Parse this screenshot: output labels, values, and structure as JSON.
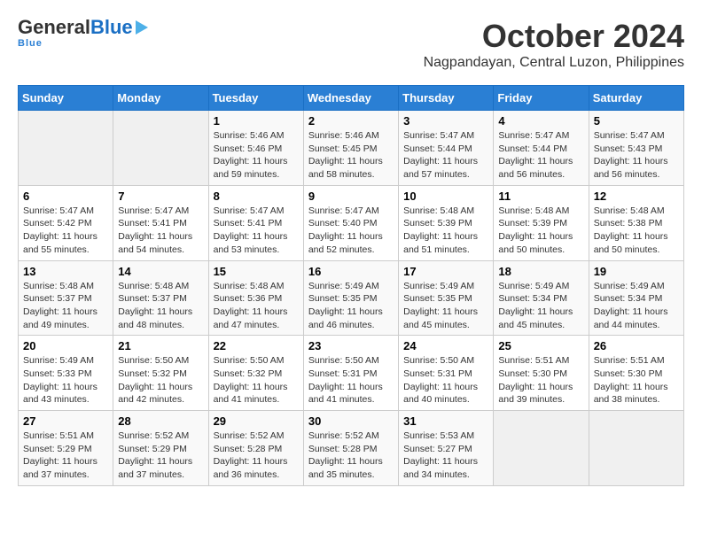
{
  "header": {
    "logo_general": "General",
    "logo_blue": "Blue",
    "month_title": "October 2024",
    "location": "Nagpandayan, Central Luzon, Philippines"
  },
  "days_of_week": [
    "Sunday",
    "Monday",
    "Tuesday",
    "Wednesday",
    "Thursday",
    "Friday",
    "Saturday"
  ],
  "weeks": [
    [
      {
        "day": "",
        "info": ""
      },
      {
        "day": "",
        "info": ""
      },
      {
        "day": "1",
        "info": "Sunrise: 5:46 AM\nSunset: 5:46 PM\nDaylight: 11 hours and 59 minutes."
      },
      {
        "day": "2",
        "info": "Sunrise: 5:46 AM\nSunset: 5:45 PM\nDaylight: 11 hours and 58 minutes."
      },
      {
        "day": "3",
        "info": "Sunrise: 5:47 AM\nSunset: 5:44 PM\nDaylight: 11 hours and 57 minutes."
      },
      {
        "day": "4",
        "info": "Sunrise: 5:47 AM\nSunset: 5:44 PM\nDaylight: 11 hours and 56 minutes."
      },
      {
        "day": "5",
        "info": "Sunrise: 5:47 AM\nSunset: 5:43 PM\nDaylight: 11 hours and 56 minutes."
      }
    ],
    [
      {
        "day": "6",
        "info": "Sunrise: 5:47 AM\nSunset: 5:42 PM\nDaylight: 11 hours and 55 minutes."
      },
      {
        "day": "7",
        "info": "Sunrise: 5:47 AM\nSunset: 5:41 PM\nDaylight: 11 hours and 54 minutes."
      },
      {
        "day": "8",
        "info": "Sunrise: 5:47 AM\nSunset: 5:41 PM\nDaylight: 11 hours and 53 minutes."
      },
      {
        "day": "9",
        "info": "Sunrise: 5:47 AM\nSunset: 5:40 PM\nDaylight: 11 hours and 52 minutes."
      },
      {
        "day": "10",
        "info": "Sunrise: 5:48 AM\nSunset: 5:39 PM\nDaylight: 11 hours and 51 minutes."
      },
      {
        "day": "11",
        "info": "Sunrise: 5:48 AM\nSunset: 5:39 PM\nDaylight: 11 hours and 50 minutes."
      },
      {
        "day": "12",
        "info": "Sunrise: 5:48 AM\nSunset: 5:38 PM\nDaylight: 11 hours and 50 minutes."
      }
    ],
    [
      {
        "day": "13",
        "info": "Sunrise: 5:48 AM\nSunset: 5:37 PM\nDaylight: 11 hours and 49 minutes."
      },
      {
        "day": "14",
        "info": "Sunrise: 5:48 AM\nSunset: 5:37 PM\nDaylight: 11 hours and 48 minutes."
      },
      {
        "day": "15",
        "info": "Sunrise: 5:48 AM\nSunset: 5:36 PM\nDaylight: 11 hours and 47 minutes."
      },
      {
        "day": "16",
        "info": "Sunrise: 5:49 AM\nSunset: 5:35 PM\nDaylight: 11 hours and 46 minutes."
      },
      {
        "day": "17",
        "info": "Sunrise: 5:49 AM\nSunset: 5:35 PM\nDaylight: 11 hours and 45 minutes."
      },
      {
        "day": "18",
        "info": "Sunrise: 5:49 AM\nSunset: 5:34 PM\nDaylight: 11 hours and 45 minutes."
      },
      {
        "day": "19",
        "info": "Sunrise: 5:49 AM\nSunset: 5:34 PM\nDaylight: 11 hours and 44 minutes."
      }
    ],
    [
      {
        "day": "20",
        "info": "Sunrise: 5:49 AM\nSunset: 5:33 PM\nDaylight: 11 hours and 43 minutes."
      },
      {
        "day": "21",
        "info": "Sunrise: 5:50 AM\nSunset: 5:32 PM\nDaylight: 11 hours and 42 minutes."
      },
      {
        "day": "22",
        "info": "Sunrise: 5:50 AM\nSunset: 5:32 PM\nDaylight: 11 hours and 41 minutes."
      },
      {
        "day": "23",
        "info": "Sunrise: 5:50 AM\nSunset: 5:31 PM\nDaylight: 11 hours and 41 minutes."
      },
      {
        "day": "24",
        "info": "Sunrise: 5:50 AM\nSunset: 5:31 PM\nDaylight: 11 hours and 40 minutes."
      },
      {
        "day": "25",
        "info": "Sunrise: 5:51 AM\nSunset: 5:30 PM\nDaylight: 11 hours and 39 minutes."
      },
      {
        "day": "26",
        "info": "Sunrise: 5:51 AM\nSunset: 5:30 PM\nDaylight: 11 hours and 38 minutes."
      }
    ],
    [
      {
        "day": "27",
        "info": "Sunrise: 5:51 AM\nSunset: 5:29 PM\nDaylight: 11 hours and 37 minutes."
      },
      {
        "day": "28",
        "info": "Sunrise: 5:52 AM\nSunset: 5:29 PM\nDaylight: 11 hours and 37 minutes."
      },
      {
        "day": "29",
        "info": "Sunrise: 5:52 AM\nSunset: 5:28 PM\nDaylight: 11 hours and 36 minutes."
      },
      {
        "day": "30",
        "info": "Sunrise: 5:52 AM\nSunset: 5:28 PM\nDaylight: 11 hours and 35 minutes."
      },
      {
        "day": "31",
        "info": "Sunrise: 5:53 AM\nSunset: 5:27 PM\nDaylight: 11 hours and 34 minutes."
      },
      {
        "day": "",
        "info": ""
      },
      {
        "day": "",
        "info": ""
      }
    ]
  ]
}
